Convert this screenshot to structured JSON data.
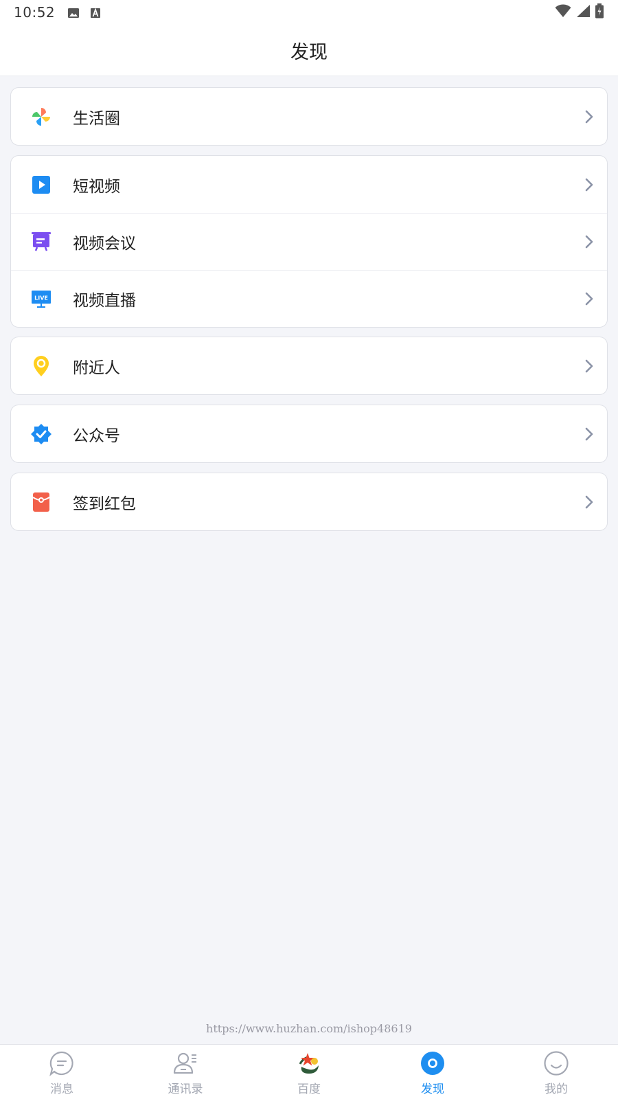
{
  "status_bar": {
    "time": "10:52",
    "icons": [
      "image-icon",
      "a-badge-icon",
      "wifi-icon",
      "signal-icon",
      "battery-icon"
    ]
  },
  "header": {
    "title": "发现"
  },
  "groups": [
    {
      "items": [
        {
          "label": "生活圈",
          "icon": "pinwheel-icon"
        }
      ]
    },
    {
      "items": [
        {
          "label": "短视频",
          "icon": "play-icon"
        },
        {
          "label": "视频会议",
          "icon": "presentation-icon"
        },
        {
          "label": "视频直播",
          "icon": "live-icon"
        }
      ]
    },
    {
      "items": [
        {
          "label": "附近人",
          "icon": "location-pin-icon"
        }
      ]
    },
    {
      "items": [
        {
          "label": "公众号",
          "icon": "verified-badge-icon"
        }
      ]
    },
    {
      "items": [
        {
          "label": "签到红包",
          "icon": "red-envelope-icon"
        }
      ]
    }
  ],
  "watermark": "https://www.huzhan.com/ishop48619",
  "tabbar": {
    "tabs": [
      {
        "label": "消息",
        "icon": "message-icon",
        "active": false
      },
      {
        "label": "通讯录",
        "icon": "contacts-icon",
        "active": false
      },
      {
        "label": "百度",
        "icon": "app-logo-icon",
        "active": false
      },
      {
        "label": "发现",
        "icon": "discover-icon",
        "active": true
      },
      {
        "label": "我的",
        "icon": "profile-smile-icon",
        "active": false
      }
    ]
  },
  "colors": {
    "accent": "#1e8ef0",
    "background": "#f4f5f9",
    "inactive_tab": "#a4a8b3"
  }
}
